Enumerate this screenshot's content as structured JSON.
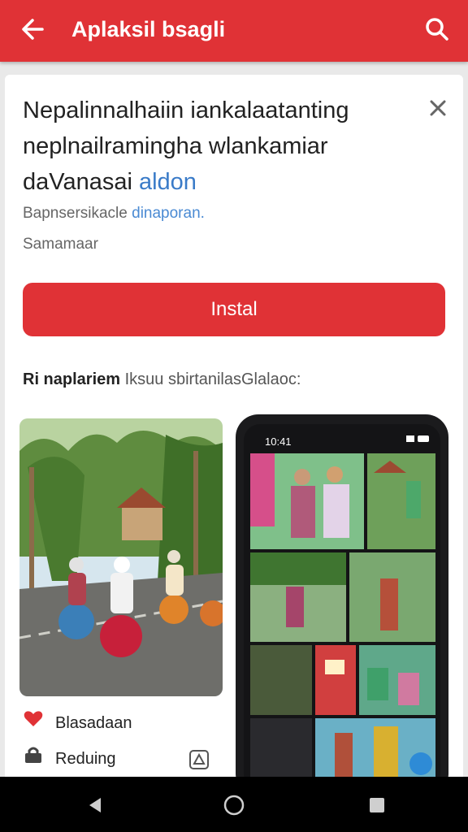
{
  "appbar": {
    "title": "Aplaksil bsagli"
  },
  "card": {
    "headline_line1": "Nepalinnalhaiin iankalaatanting",
    "headline_line2": "neplnailramingha wlankamiar",
    "headline_line3": "daVanasai ",
    "headline_link": "aldon",
    "subline_text": "Bapnsersikacle ",
    "subline_link": "dinaporan.",
    "meta": "Samamaar",
    "install_label": "Instal",
    "section_bold": "Ri naplariem",
    "section_rest": " Iksuu sbirtanilasGlalaoc:",
    "phone_time": "10:41",
    "row1_label": "Blasadaan",
    "row2_label": "Reduing"
  },
  "colors": {
    "brand_red": "#e03236",
    "accent_blue": "#3a7bc8"
  },
  "icons": [
    "back-arrow-icon",
    "search-icon",
    "close-icon",
    "heart-tag-icon",
    "lock-icon",
    "caution-icon"
  ]
}
